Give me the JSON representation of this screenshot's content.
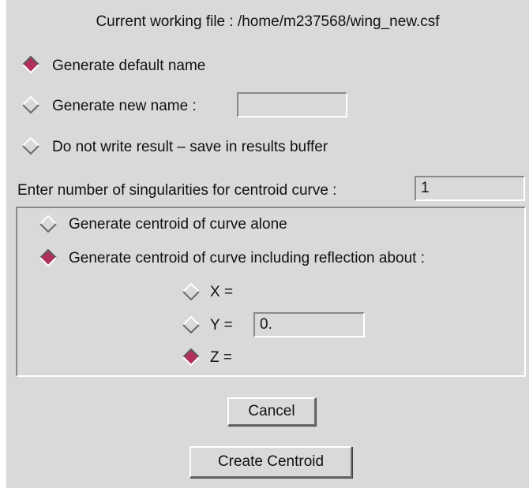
{
  "dialog": {
    "title": "Current working file : /home/m237568/wing_new.csf"
  },
  "output": {
    "options": [
      {
        "label": "Generate default name",
        "selected": true
      },
      {
        "label": "Generate new name :",
        "selected": false
      },
      {
        "label": "Do not write result – save in results buffer",
        "selected": false
      }
    ],
    "new_name_value": ""
  },
  "singularities": {
    "label": "Enter number of singularities for centroid curve :",
    "value": "1"
  },
  "centroid_mode": {
    "options": [
      {
        "label": "Generate centroid of curve alone",
        "selected": false
      },
      {
        "label": "Generate centroid of curve including reflection about :",
        "selected": true
      }
    ]
  },
  "reflection_axes": [
    {
      "label": "X =",
      "selected": false
    },
    {
      "label": "Y =",
      "selected": false,
      "value": "0."
    },
    {
      "label": "Z =",
      "selected": true
    }
  ],
  "buttons": {
    "cancel": "Cancel",
    "create": "Create Centroid"
  },
  "colors": {
    "dialog_bg": "#d9d9d9",
    "radio_selected": "#b0305a",
    "radio_unselected": "#d9d9d9"
  }
}
